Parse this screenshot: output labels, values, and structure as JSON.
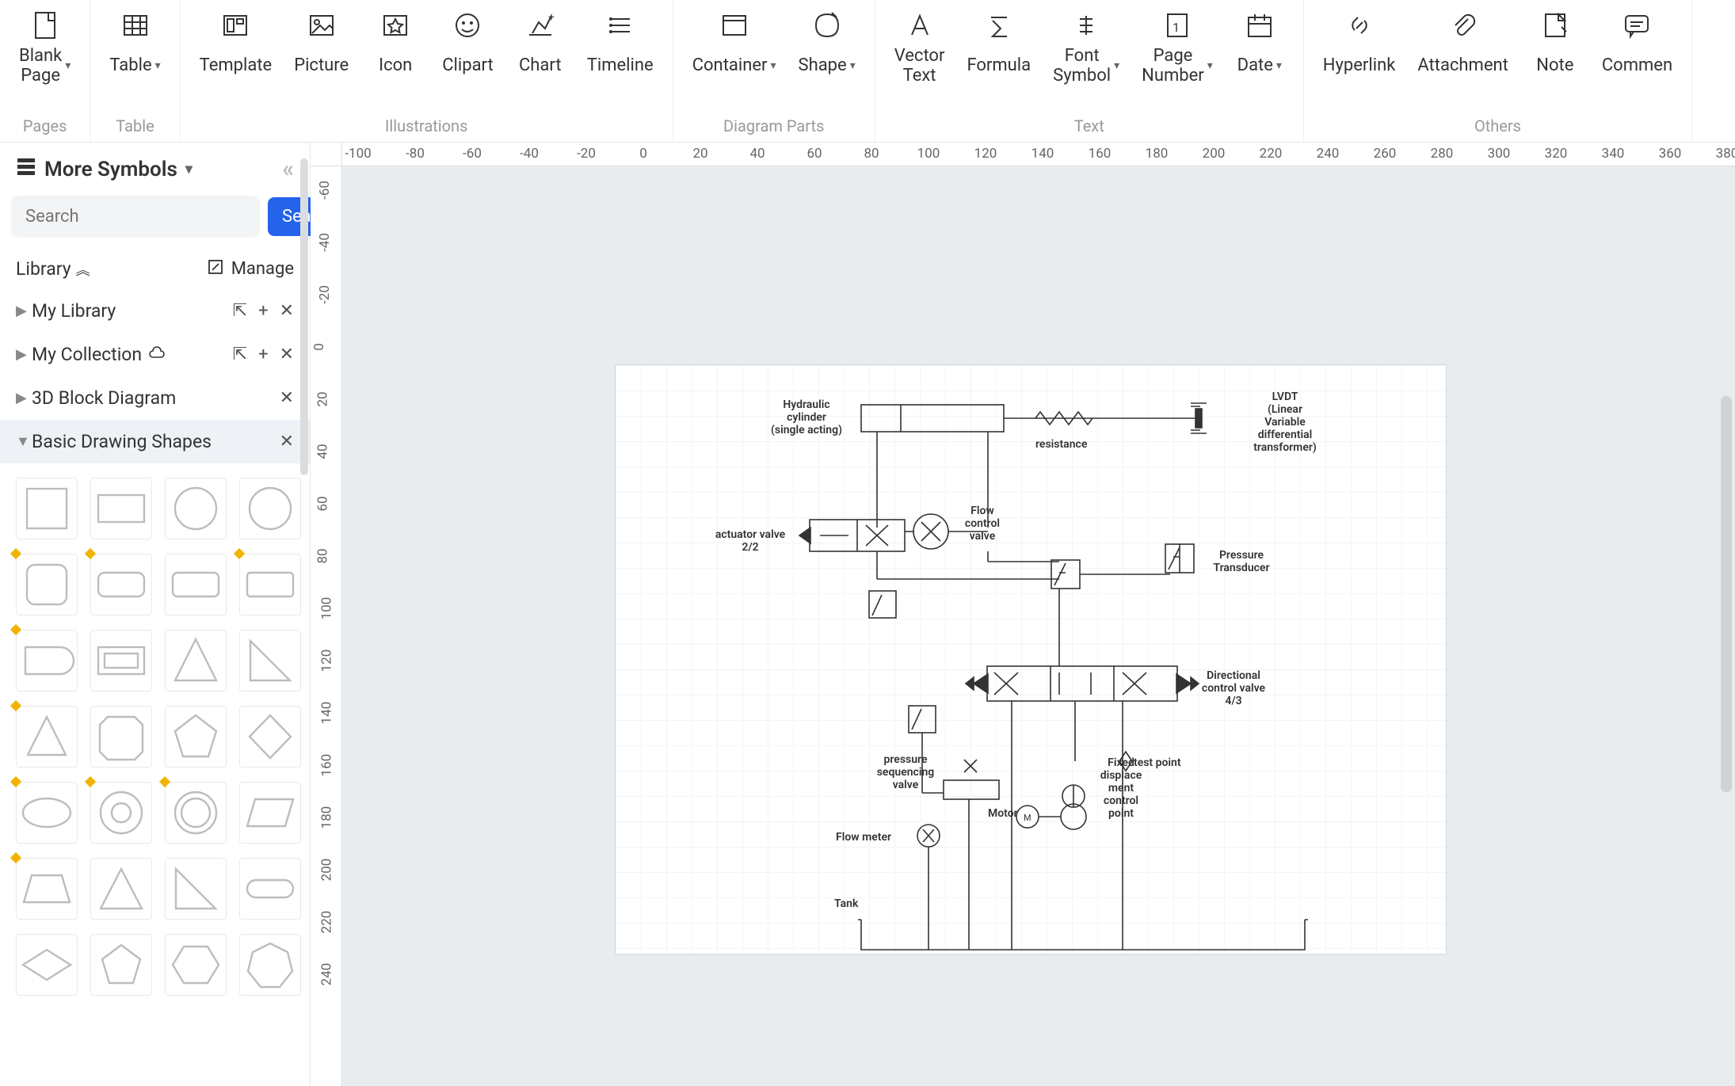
{
  "ribbon": {
    "groups": [
      {
        "title": "Pages",
        "buttons": [
          {
            "label": "Blank\nPage",
            "icon": "blank-page",
            "caret": true
          }
        ]
      },
      {
        "title": "Table",
        "buttons": [
          {
            "label": "Table",
            "icon": "table",
            "caret": true
          }
        ]
      },
      {
        "title": "Illustrations",
        "buttons": [
          {
            "label": "Template",
            "icon": "template"
          },
          {
            "label": "Picture",
            "icon": "picture"
          },
          {
            "label": "Icon",
            "icon": "icon-star"
          },
          {
            "label": "Clipart",
            "icon": "clipart"
          },
          {
            "label": "Chart",
            "icon": "chart"
          },
          {
            "label": "Timeline",
            "icon": "timeline"
          }
        ]
      },
      {
        "title": "Diagram Parts",
        "buttons": [
          {
            "label": "Container",
            "icon": "container",
            "caret": true
          },
          {
            "label": "Shape",
            "icon": "shape",
            "caret": true
          }
        ]
      },
      {
        "title": "Text",
        "buttons": [
          {
            "label": "Vector\nText",
            "icon": "vector-text"
          },
          {
            "label": "Formula",
            "icon": "formula"
          },
          {
            "label": "Font\nSymbol",
            "icon": "font-symbol",
            "caret": true
          },
          {
            "label": "Page\nNumber",
            "icon": "page-number",
            "caret": true
          },
          {
            "label": "Date",
            "icon": "date",
            "caret": true
          }
        ]
      },
      {
        "title": "Others",
        "buttons": [
          {
            "label": "Hyperlink",
            "icon": "hyperlink"
          },
          {
            "label": "Attachment",
            "icon": "attachment"
          },
          {
            "label": "Note",
            "icon": "note"
          },
          {
            "label": "Commen",
            "icon": "comment"
          }
        ]
      }
    ]
  },
  "sidebar": {
    "title": "More Symbols",
    "search_placeholder": "Search",
    "search_button": "Search",
    "library_label": "Library",
    "manage_label": "Manage",
    "categories": [
      {
        "label": "My Library",
        "cloud": false,
        "actions": [
          "import",
          "add",
          "close"
        ]
      },
      {
        "label": "My Collection",
        "cloud": true,
        "actions": [
          "import",
          "add",
          "close"
        ]
      },
      {
        "label": "3D Block Diagram",
        "cloud": false,
        "actions": [
          "close"
        ]
      },
      {
        "label": "Basic Drawing Shapes",
        "cloud": false,
        "actions": [
          "close"
        ],
        "expanded": true
      }
    ]
  },
  "ruler_h": [
    "-100",
    "-80",
    "-60",
    "-40",
    "-20",
    "0",
    "20",
    "40",
    "60",
    "80",
    "100",
    "120",
    "140",
    "160",
    "180",
    "200",
    "220",
    "240",
    "260",
    "280",
    "300",
    "320",
    "340",
    "360",
    "380"
  ],
  "ruler_v": [
    "-60",
    "-40",
    "-20",
    "0",
    "20",
    "40",
    "60",
    "80",
    "100",
    "120",
    "140",
    "160",
    "180",
    "200",
    "220",
    "240"
  ],
  "diagram": {
    "labels": {
      "hydraulic_cylinder": "Hydraulic\ncylinder\n(single acting)",
      "resistance": "resistance",
      "lvdt": "LVDT\n(Linear\nVariable\ndifferential\ntransformer)",
      "actuator_valve": "actuator valve\n2/2",
      "flow_control_valve": "Flow\ncontrol\nvalve",
      "pressure_transducer": "Pressure\nTransducer",
      "directional_valve": "Directional\ncontrol valve\n4/3",
      "pressure_sequencing": "pressure\nsequencing\nvalve",
      "test_point": "test point",
      "fixed_displacement": "Fixed\ndisplace\nment\ncontrol\npoint",
      "motor": "Motor",
      "flow_meter": "Flow meter",
      "tank": "Tank"
    }
  }
}
